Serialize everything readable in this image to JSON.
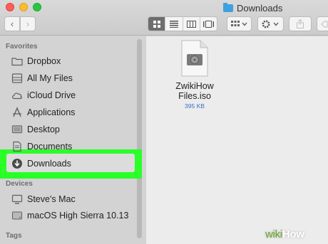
{
  "window": {
    "title": "Downloads"
  },
  "toolbar": {
    "back_glyph": "‹",
    "forward_glyph": "›"
  },
  "sidebar": {
    "sections": [
      {
        "heading": "Favorites"
      },
      {
        "heading": "Devices"
      },
      {
        "heading": "Tags"
      }
    ],
    "favorites": [
      {
        "label": "Dropbox",
        "icon": "dropbox-folder-icon"
      },
      {
        "label": "All My Files",
        "icon": "all-files-icon"
      },
      {
        "label": "iCloud Drive",
        "icon": "cloud-icon"
      },
      {
        "label": "Applications",
        "icon": "applications-icon"
      },
      {
        "label": "Desktop",
        "icon": "desktop-icon"
      },
      {
        "label": "Documents",
        "icon": "documents-icon"
      },
      {
        "label": "Downloads",
        "icon": "downloads-icon",
        "selected": true
      }
    ],
    "devices": [
      {
        "label": "Steve's Mac",
        "icon": "computer-icon"
      },
      {
        "label": "macOS High Sierra 10.13",
        "icon": "disk-icon"
      }
    ]
  },
  "content": {
    "files": [
      {
        "name_line1": "ZwikiHow",
        "name_line2": "Files.iso",
        "size": "395 KB",
        "icon": "disk-image-icon"
      }
    ]
  },
  "watermark": {
    "prefix": "wiki",
    "suffix": "How"
  },
  "colors": {
    "highlight": "#2aff28",
    "folder_blue": "#3ea0df",
    "size_text": "#3a6fc4"
  }
}
